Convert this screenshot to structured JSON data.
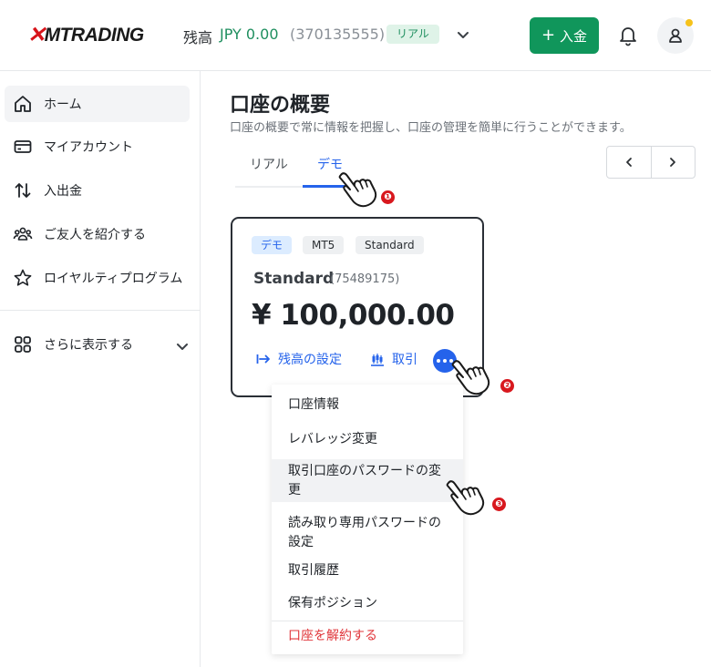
{
  "header": {
    "logo_mark": "✕",
    "logo_text": "MTRADING",
    "balance_label": "残高",
    "balance_value": "JPY 0.00",
    "account_number": "(370135555)",
    "account_type_badge": "リアル",
    "deposit_button": "入金",
    "colors": {
      "accent_green": "#10965b",
      "notification_dot": "#f6c21a"
    }
  },
  "sidebar": {
    "items": [
      {
        "label": "ホーム",
        "icon": "home-icon"
      },
      {
        "label": "マイアカウント",
        "icon": "card-icon"
      },
      {
        "label": "入出金",
        "icon": "transfer-icon"
      },
      {
        "label": "ご友人を紹介する",
        "icon": "people-icon"
      },
      {
        "label": "ロイヤルティプログラム",
        "icon": "star-icon"
      }
    ],
    "more_label": "さらに表示する"
  },
  "main": {
    "title": "口座の概要",
    "subtitle": "口座の概要で常に情報を把握し、口座の管理を簡単に行うことができます。",
    "tabs": [
      {
        "label": "リアル",
        "active": false
      },
      {
        "label": "デモ",
        "active": true
      }
    ]
  },
  "account_card": {
    "tags": [
      "デモ",
      "MT5",
      "Standard"
    ],
    "name": "Standard",
    "number": "(75489175)",
    "balance": "¥ 100,000.00",
    "set_balance_label": "残高の設定",
    "trade_label": "取引"
  },
  "menu": {
    "items": [
      {
        "label": "口座情報"
      },
      {
        "label": "レバレッジ変更"
      },
      {
        "label": "取引口座のパスワードの変更",
        "highlighted": true
      },
      {
        "label": "読み取り専用パスワードの設定"
      },
      {
        "label": "取引履歴"
      },
      {
        "label": "保有ポジション"
      },
      {
        "label": "口座を解約する",
        "danger": true
      }
    ]
  },
  "annotations": [
    "❶",
    "❷",
    "❸"
  ],
  "colors": {
    "primary_blue": "#2563eb",
    "danger_red": "#e0353a",
    "marker_red": "#d8181e"
  }
}
